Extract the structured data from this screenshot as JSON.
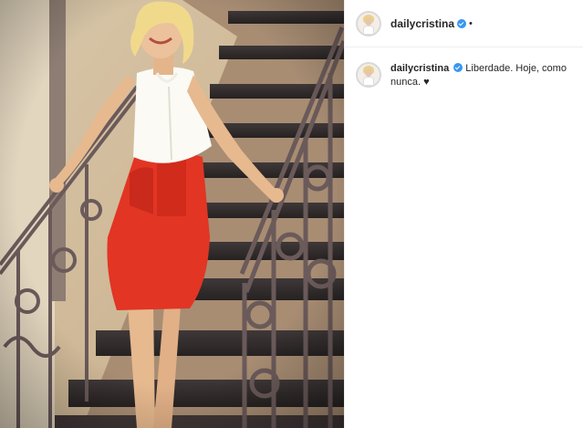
{
  "post": {
    "username": "dailycristina",
    "header_separator": "•",
    "caption": "Liberdade. Hoje, como nunca. ♥",
    "icons": {
      "verified": "verified-badge-icon",
      "avatar": "profile-avatar"
    },
    "colors": {
      "verified_blue": "#3897f0",
      "text": "#262626",
      "divider": "#efefef"
    }
  }
}
